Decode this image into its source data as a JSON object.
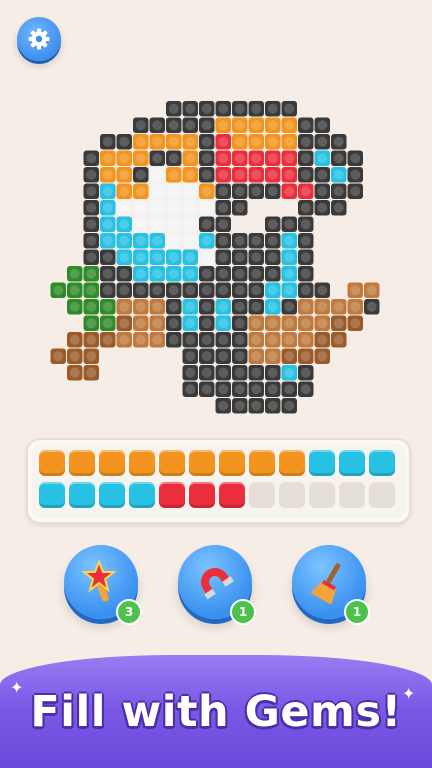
{
  "settings": {
    "icon": "gear-icon"
  },
  "artwork": {
    "subject": "toucan-on-branch",
    "palette": {
      "K": "#3a3a3a",
      "O": "#f2941e",
      "R": "#ea2e3c",
      "C": "#26c1e3",
      "W": "#f4f4f4",
      "G": "#2f8a2a",
      "B": "#9b5a2a",
      "L": "#c07a3f"
    },
    "rows": [
      "....................",
      ".......KKKKKKKK.....",
      ".....KKKKKOOOOOKK...",
      "...KKOOOOKROOOOKKK..",
      "..KOOOKKOKRRRRRKCKK.",
      "..KOOKWOOKRRRRRKKCK.",
      "..KCOOWWWOKKKKRRKKK.",
      "..KCWWWWWWKK...KKK..",
      "..KCCWWWWKK..KKK....",
      "..KCCCCWWCKKKKCK....",
      "..KKCCCCCWKKKKCK....",
      ".GGKKCCCCKKKKKCK....",
      "GGGKKKKKKKKKKCCKK.LL",
      ".GGGLLLKCKCKKCKLLLLK",
      "..GGBLLKCKCKLLLLLBB.",
      ".BBBLLLKKKKKLLLLBB..",
      "BBB.....KKKKLLBBB...",
      ".BB.....KKKKKKCK....",
      "........KKKKKKKK....",
      "..........KKKKK....."
    ]
  },
  "tray": {
    "slots": [
      "orange",
      "orange",
      "orange",
      "orange",
      "orange",
      "orange",
      "orange",
      "orange",
      "orange",
      "cyan",
      "cyan",
      "cyan",
      "cyan",
      "cyan",
      "cyan",
      "cyan",
      "red",
      "red",
      "red",
      "empty",
      "empty",
      "empty",
      "empty",
      "empty"
    ],
    "colors": {
      "orange": "#f2941e",
      "cyan": "#26c1e3",
      "red": "#ea2e3c",
      "empty": "#e6dfd8"
    }
  },
  "powerups": [
    {
      "name": "magic-wand",
      "icon": "star-wand-icon",
      "count": "3"
    },
    {
      "name": "magnet",
      "icon": "magnet-icon",
      "count": "1"
    },
    {
      "name": "broom",
      "icon": "broom-icon",
      "count": "1"
    }
  ],
  "banner": {
    "text": "Fill with Gems!"
  }
}
